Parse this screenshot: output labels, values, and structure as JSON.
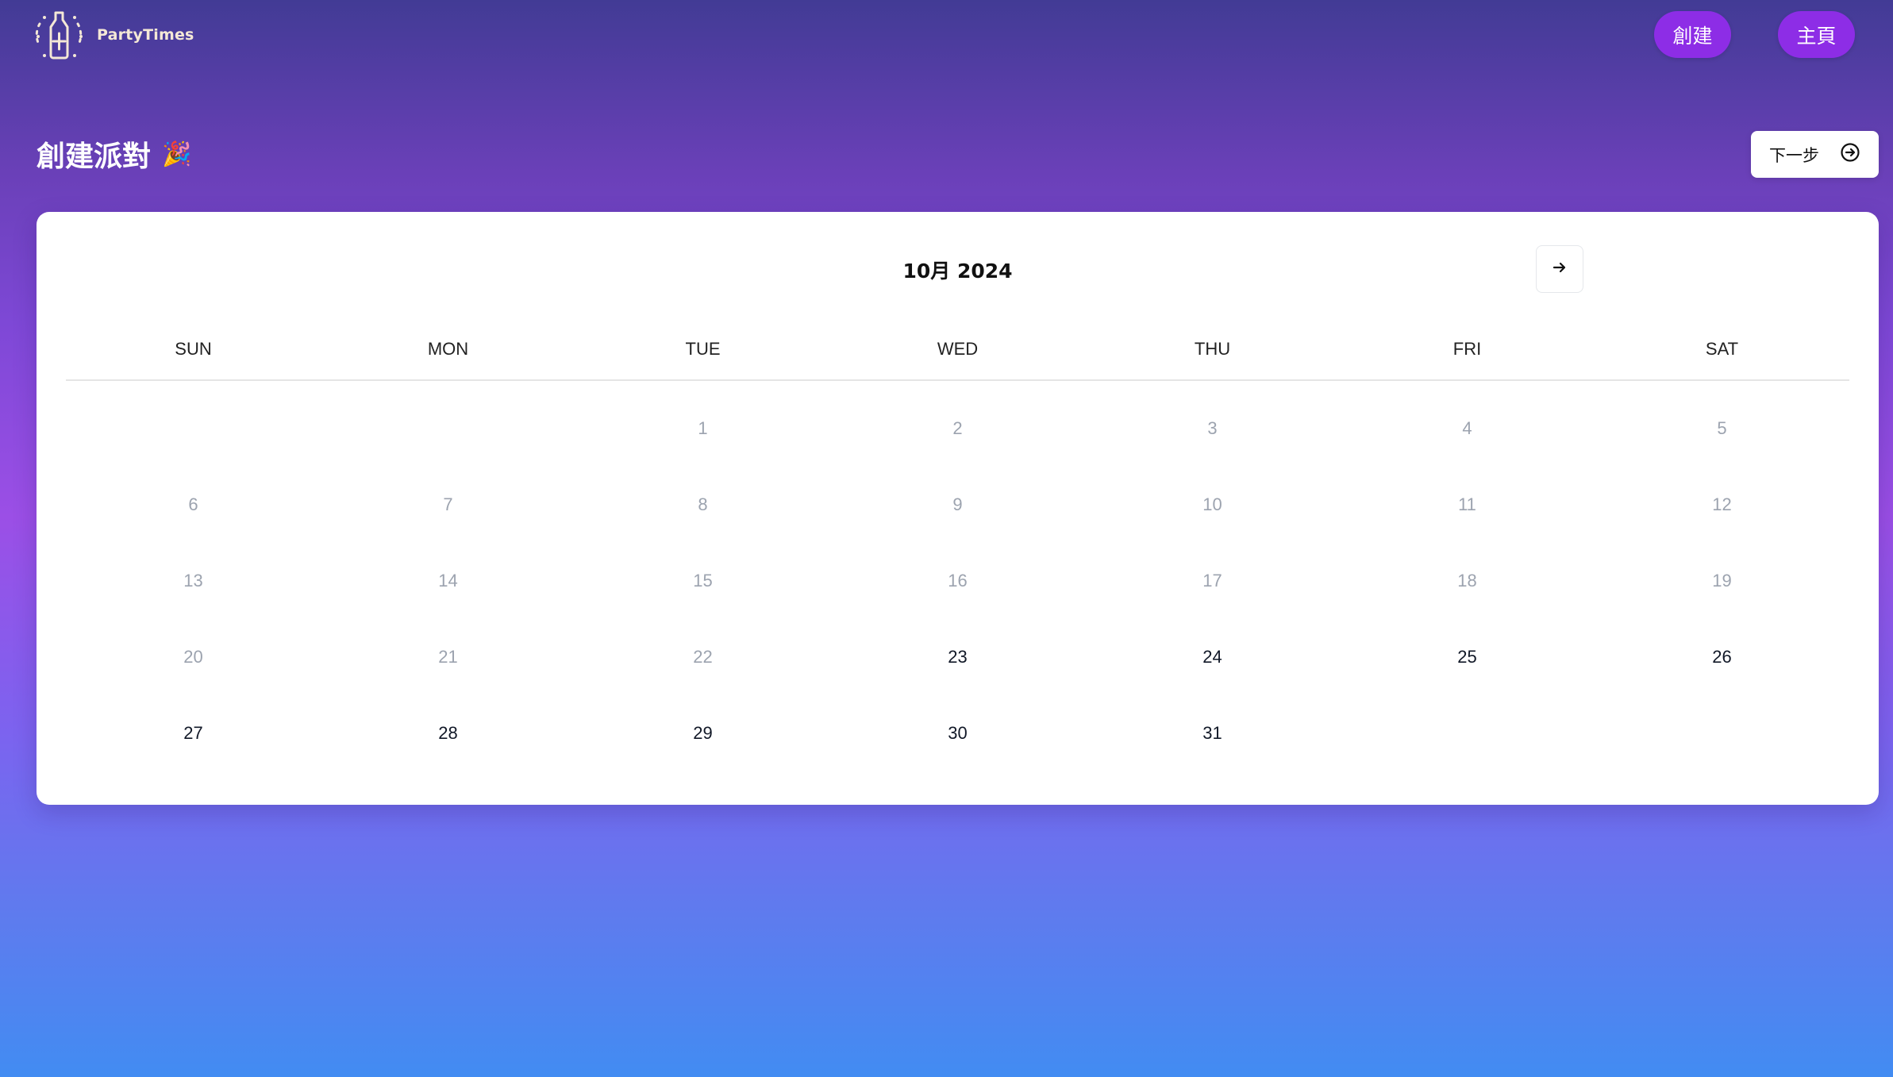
{
  "app": {
    "logo_text": "PartyTimes"
  },
  "header": {
    "nav": [
      {
        "label": "創建"
      },
      {
        "label": "主頁"
      }
    ]
  },
  "page": {
    "title": "創建派對",
    "title_emoji": "🎉",
    "next_button_label": "下一步"
  },
  "calendar": {
    "month_label": "10月 2024",
    "weekdays": [
      "SUN",
      "MON",
      "TUE",
      "WED",
      "THU",
      "FRI",
      "SAT"
    ],
    "leading_blanks": 2,
    "days": [
      {
        "d": "1",
        "s": "past"
      },
      {
        "d": "2",
        "s": "past"
      },
      {
        "d": "3",
        "s": "past"
      },
      {
        "d": "4",
        "s": "past"
      },
      {
        "d": "5",
        "s": "past"
      },
      {
        "d": "6",
        "s": "past"
      },
      {
        "d": "7",
        "s": "past"
      },
      {
        "d": "8",
        "s": "past"
      },
      {
        "d": "9",
        "s": "past"
      },
      {
        "d": "10",
        "s": "past"
      },
      {
        "d": "11",
        "s": "past"
      },
      {
        "d": "12",
        "s": "past"
      },
      {
        "d": "13",
        "s": "past"
      },
      {
        "d": "14",
        "s": "past"
      },
      {
        "d": "15",
        "s": "past"
      },
      {
        "d": "16",
        "s": "past"
      },
      {
        "d": "17",
        "s": "past"
      },
      {
        "d": "18",
        "s": "past"
      },
      {
        "d": "19",
        "s": "past"
      },
      {
        "d": "20",
        "s": "past"
      },
      {
        "d": "21",
        "s": "past"
      },
      {
        "d": "22",
        "s": "past"
      },
      {
        "d": "23",
        "s": "avail"
      },
      {
        "d": "24",
        "s": "avail"
      },
      {
        "d": "25",
        "s": "avail"
      },
      {
        "d": "26",
        "s": "avail"
      },
      {
        "d": "27",
        "s": "avail"
      },
      {
        "d": "28",
        "s": "avail"
      },
      {
        "d": "29",
        "s": "avail"
      },
      {
        "d": "30",
        "s": "avail"
      },
      {
        "d": "31",
        "s": "avail"
      }
    ]
  },
  "icons": {
    "logo": "champagne-bottle-icon",
    "next": "arrow-circle-right-icon",
    "month_next": "arrow-right-icon"
  },
  "colors": {
    "nav_button": "#8d2de6",
    "past_day": "#9ca3af",
    "available_day": "#111827"
  }
}
